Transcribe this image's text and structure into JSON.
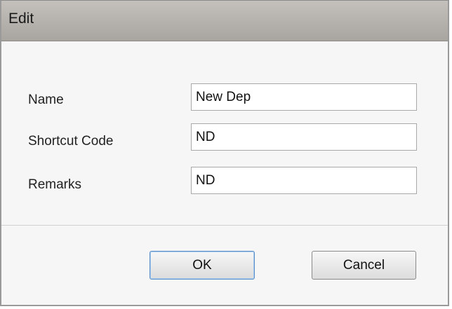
{
  "dialog": {
    "title": "Edit"
  },
  "form": {
    "name": {
      "label": "Name",
      "value": "New Dep"
    },
    "shortcut_code": {
      "label": "Shortcut Code",
      "value": "ND"
    },
    "remarks": {
      "label": "Remarks",
      "value": "ND"
    }
  },
  "buttons": {
    "ok_label": "OK",
    "cancel_label": "Cancel"
  }
}
